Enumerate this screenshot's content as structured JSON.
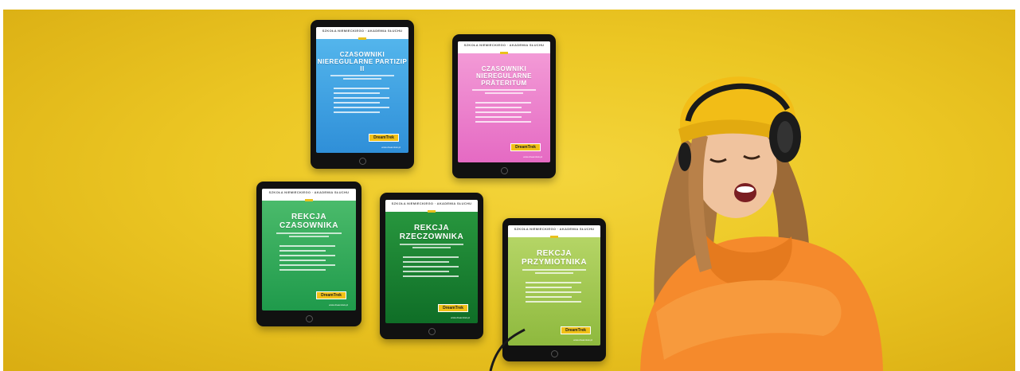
{
  "tablets": [
    {
      "header": "SZKOŁA NIEMIECKIEGO · AKADEMIA SŁUCHU",
      "title": "CZASOWNIKI NIEREGULARNE PARTIZIP II",
      "brand": "DreamTrek",
      "url": "www.dreamtrek.pl"
    },
    {
      "header": "SZKOŁA NIEMIECKIEGO · AKADEMIA SŁUCHU",
      "title": "CZASOWNIKI NIEREGULARNE PRÄTERITUM",
      "brand": "DreamTrek",
      "url": "www.dreamtrek.pl"
    },
    {
      "header": "SZKOŁA NIEMIECKIEGO · AKADEMIA SŁUCHU",
      "title": "REKCJA CZASOWNIKA",
      "brand": "DreamTrek",
      "url": "www.dreamtrek.pl"
    },
    {
      "header": "SZKOŁA NIEMIECKIEGO · AKADEMIA SŁUCHU",
      "title": "REKCJA RZECZOWNIKA",
      "brand": "DreamTrek",
      "url": "www.dreamtrek.pl"
    },
    {
      "header": "SZKOŁA NIEMIECKIEGO · AKADEMIA SŁUCHU",
      "title": "REKCJA PRZYMIOTNIKA",
      "brand": "DreamTrek",
      "url": "www.dreamtrek.pl"
    }
  ],
  "colors": {
    "background": "#ecc724",
    "blue": "#3fa2e2",
    "pink": "#ee86cd",
    "green_light": "#33ad5b",
    "green_dark": "#1a8334",
    "lime": "#a4c853",
    "sweater": "#f58a2c",
    "beanie": "#f2bd17"
  }
}
